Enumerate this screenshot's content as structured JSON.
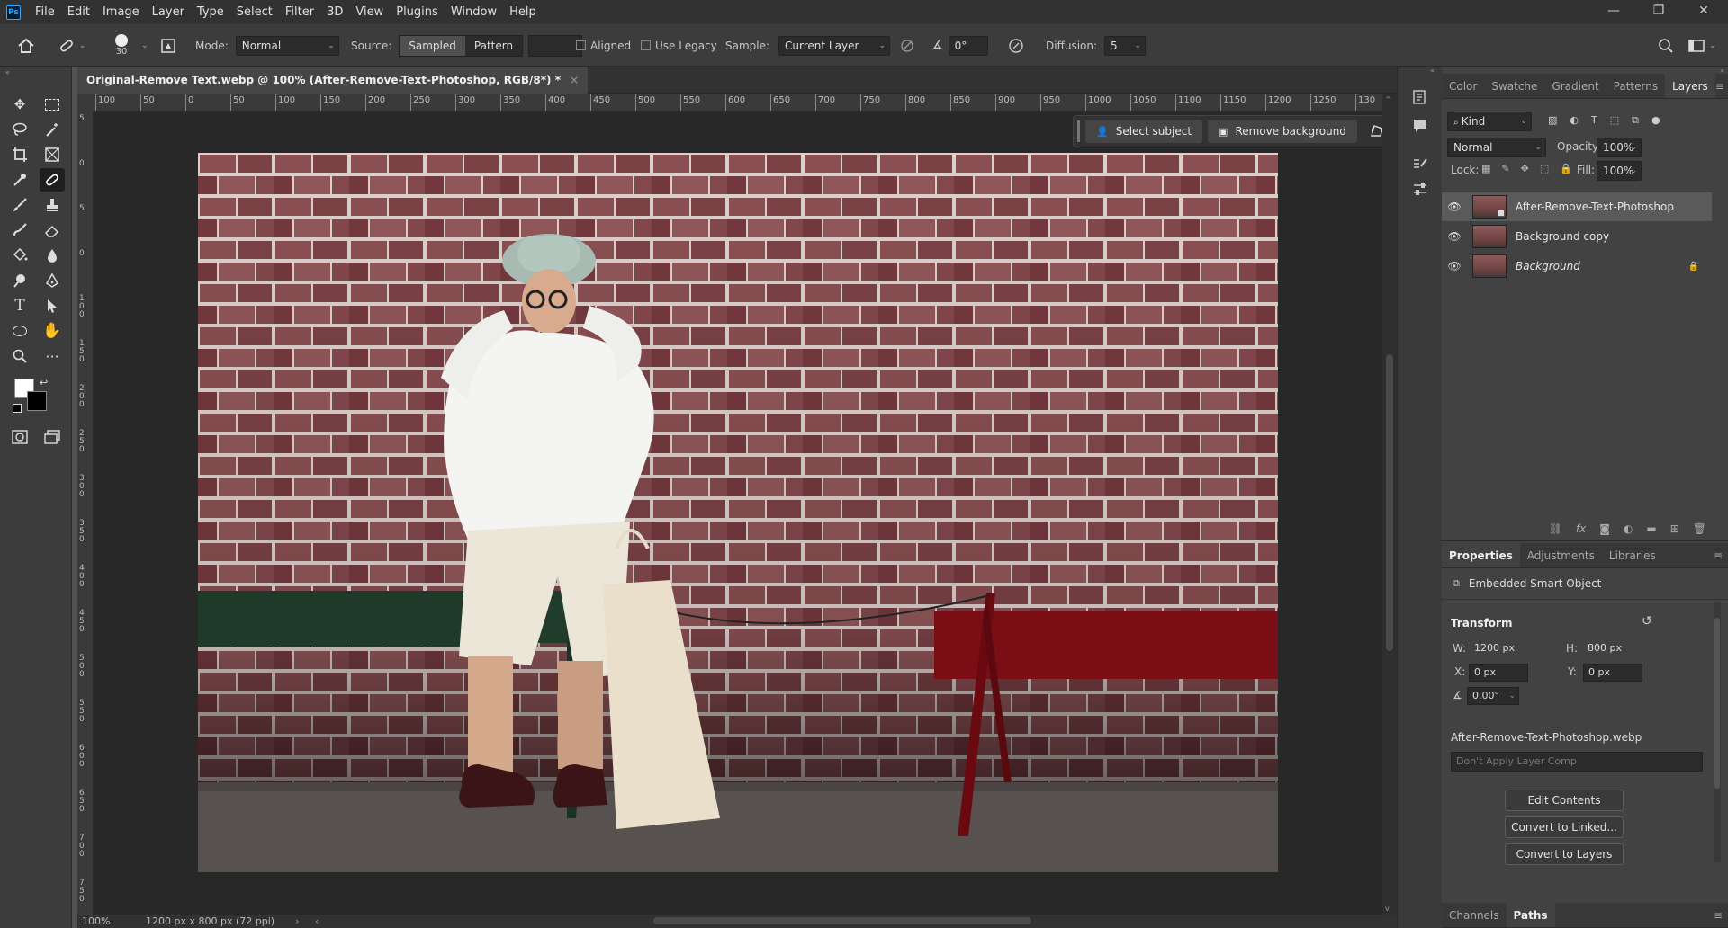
{
  "app": {
    "logo": "Ps"
  },
  "menu": [
    "File",
    "Edit",
    "Image",
    "Layer",
    "Type",
    "Select",
    "Filter",
    "3D",
    "View",
    "Plugins",
    "Window",
    "Help"
  ],
  "window_controls": {
    "minimize": "—",
    "restore": "❐",
    "close": "✕"
  },
  "options_bar": {
    "brush_size": "30",
    "mode_label": "Mode:",
    "mode_value": "Normal",
    "source_label": "Source:",
    "source_options": [
      "Sampled",
      "Pattern"
    ],
    "source_selected": "Sampled",
    "aligned_label": "Aligned",
    "use_legacy_label": "Use Legacy",
    "sample_label": "Sample:",
    "sample_value": "Current Layer",
    "angle_value": "0°",
    "diffusion_label": "Diffusion:",
    "diffusion_value": "5"
  },
  "document": {
    "tab_title": "Original-Remove Text.webp @ 100% (After-Remove-Text-Photoshop, RGB/8*) *",
    "zoom": "100%",
    "info": "1200 px x 800 px (72 ppi)"
  },
  "ruler": {
    "h_labels": [
      "100",
      "50",
      "0",
      "50",
      "100",
      "150",
      "200",
      "250",
      "300",
      "350",
      "400",
      "450",
      "500",
      "550",
      "600",
      "650",
      "700",
      "750",
      "800",
      "850",
      "900",
      "950",
      "1000",
      "1050",
      "1100",
      "1150",
      "1200",
      "1250",
      "130"
    ],
    "v_labels": [
      "5",
      "0",
      "5",
      "0",
      "1 0 0",
      "1 5 0",
      "2 0 0",
      "2 5 0",
      "3 0 0",
      "3 5 0",
      "4 0 0",
      "4 5 0",
      "5 0 0",
      "5 5 0",
      "6 0 0",
      "6 5 0",
      "7 0 0",
      "7 5 0",
      "8 0 0"
    ]
  },
  "context_bar": {
    "select_subject": "Select subject",
    "remove_background": "Remove background",
    "more": "···"
  },
  "layers_panel": {
    "tabs": [
      "Color",
      "Swatche",
      "Gradient",
      "Patterns",
      "Layers"
    ],
    "active_tab": "Layers",
    "filter_kind": "Kind",
    "blend_mode": "Normal",
    "opacity_label": "Opacity:",
    "opacity": "100%",
    "lock_label": "Lock:",
    "fill_label": "Fill:",
    "fill": "100%",
    "layers": [
      {
        "name": "After-Remove-Text-Photoshop",
        "selected": true,
        "italic": false,
        "locked": false
      },
      {
        "name": "Background copy",
        "selected": false,
        "italic": false,
        "locked": false
      },
      {
        "name": "Background",
        "selected": false,
        "italic": true,
        "locked": true
      }
    ]
  },
  "properties_panel": {
    "tabs": [
      "Properties",
      "Adjustments",
      "Libraries"
    ],
    "active_tab": "Properties",
    "object_type": "Embedded Smart Object",
    "transform_label": "Transform",
    "w_label": "W:",
    "w": "1200 px",
    "h_label": "H:",
    "h": "800 px",
    "x_label": "X:",
    "x": "0 px",
    "y_label": "Y:",
    "y": "0 px",
    "angle": "0.00°",
    "filename": "After-Remove-Text-Photoshop.webp",
    "layer_comp": "Don't Apply Layer Comp",
    "buttons": {
      "edit": "Edit Contents",
      "linked": "Convert to Linked...",
      "layers": "Convert to Layers"
    }
  },
  "bottom_tabs": [
    "Channels",
    "Paths"
  ],
  "bottom_active": "Paths"
}
